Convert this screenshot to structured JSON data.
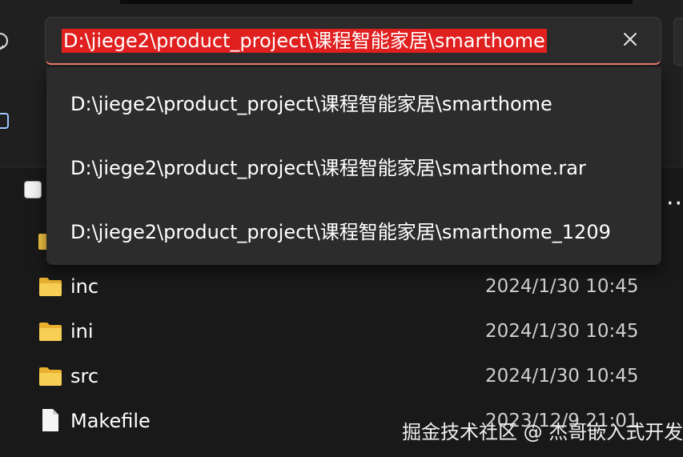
{
  "address_bar": {
    "value": "D:\\jiege2\\product_project\\课程智能家居\\smarthome"
  },
  "suggestions": [
    "D:\\jiege2\\product_project\\课程智能家居\\smarthome",
    "D:\\jiege2\\product_project\\课程智能家居\\smarthome.rar",
    "D:\\jiege2\\product_project\\课程智能家居\\smarthome_1209"
  ],
  "files": [
    {
      "name": "inc",
      "date": "2024/1/30 10:45",
      "icon": "folder-icon"
    },
    {
      "name": "ini",
      "date": "2024/1/30 10:45",
      "icon": "folder-icon"
    },
    {
      "name": "src",
      "date": "2024/1/30 10:45",
      "icon": "folder-icon"
    },
    {
      "name": "Makefile",
      "date": "2023/12/9 21:01",
      "icon": "file-icon"
    }
  ],
  "watermark": "掘金技术社区 @ 杰哥嵌入式开发",
  "icons": {
    "clear": "close-icon",
    "more": "more-options-icon",
    "refresh": "refresh-icon"
  },
  "colors": {
    "selection_highlight": "#e01f1f",
    "focus_underline": "#e9776a",
    "folder": "#f4c542",
    "background": "#191919",
    "dropdown": "#2c2c2c"
  }
}
